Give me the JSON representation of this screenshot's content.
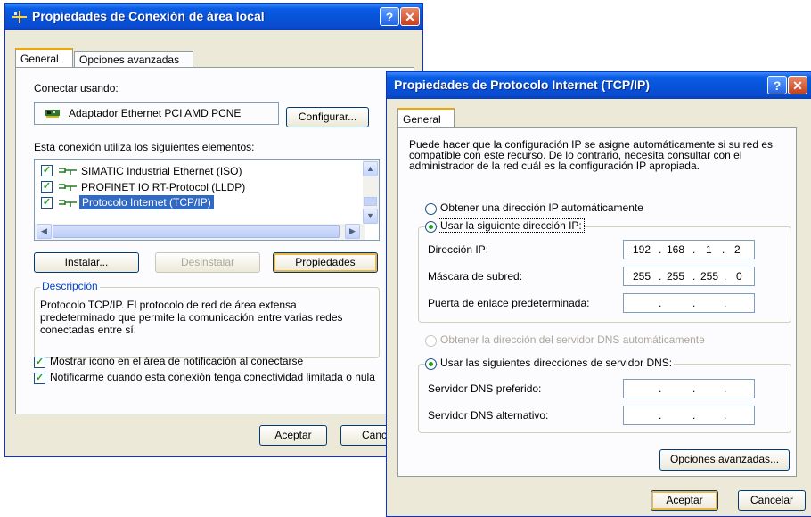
{
  "window1": {
    "title": "Propiedades de Conexión de área local",
    "help_glyph": "?",
    "close_glyph": "✕",
    "tabs": [
      "General",
      "Opciones avanzadas"
    ],
    "connect_using_label": "Conectar usando:",
    "adapter_name": "Adaptador Ethernet PCI AMD PCNE",
    "configure_button": "Configurar...",
    "elements_label": "Esta conexión utiliza los siguientes elementos:",
    "components": [
      {
        "label": "SIMATIC Industrial Ethernet (ISO)",
        "checked": true,
        "selected": false
      },
      {
        "label": "PROFINET IO RT-Protocol (LLDP)",
        "checked": true,
        "selected": false
      },
      {
        "label": "Protocolo Internet (TCP/IP)",
        "checked": true,
        "selected": true
      }
    ],
    "install_button": "Instalar...",
    "uninstall_button": "Desinstalar",
    "properties_button": "Propiedades",
    "description_legend": "Descripción",
    "description_text": "Protocolo TCP/IP. El protocolo de red de área extensa predeterminado que permite la comunicación entre varias redes conectadas entre sí.",
    "show_icon_label": "Mostrar icono en el área de notificación al conectarse",
    "notify_label": "Notificarme cuando esta conexión tenga conectividad limitada o nula",
    "accept_button": "Aceptar",
    "cancel_button_partial": "Canc"
  },
  "window2": {
    "title": "Propiedades de Protocolo Internet (TCP/IP)",
    "help_glyph": "?",
    "close_glyph": "✕",
    "tab": "General",
    "intro_text": "Puede hacer que la configuración IP se asigne automáticamente si su red es compatible con este recurso. De lo contrario, necesita consultar con el administrador de la red cuál es la configuración IP apropiada.",
    "auto_ip_label": "Obtener una dirección IP automáticamente",
    "manual_ip_label": "Usar la siguiente dirección IP:",
    "ip_label": "Dirección IP:",
    "ip_value": [
      "192",
      "168",
      "1",
      "2"
    ],
    "mask_label": "Máscara de subred:",
    "mask_value": [
      "255",
      "255",
      "255",
      "0"
    ],
    "gateway_label": "Puerta de enlace predeterminada:",
    "gateway_value": [
      "",
      "",
      "",
      ""
    ],
    "auto_dns_label": "Obtener la dirección del servidor DNS automáticamente",
    "manual_dns_label": "Usar las siguientes direcciones de servidor DNS:",
    "preferred_dns_label": "Servidor DNS preferido:",
    "alternate_dns_label": "Servidor DNS alternativo:",
    "advanced_button": "Opciones avanzadas...",
    "accept_button": "Aceptar",
    "cancel_button": "Cancelar"
  },
  "icons": {
    "adapter": "network-card-icon",
    "protocol": "network-protocol-icon",
    "titlebar": "network-connection-icon"
  }
}
